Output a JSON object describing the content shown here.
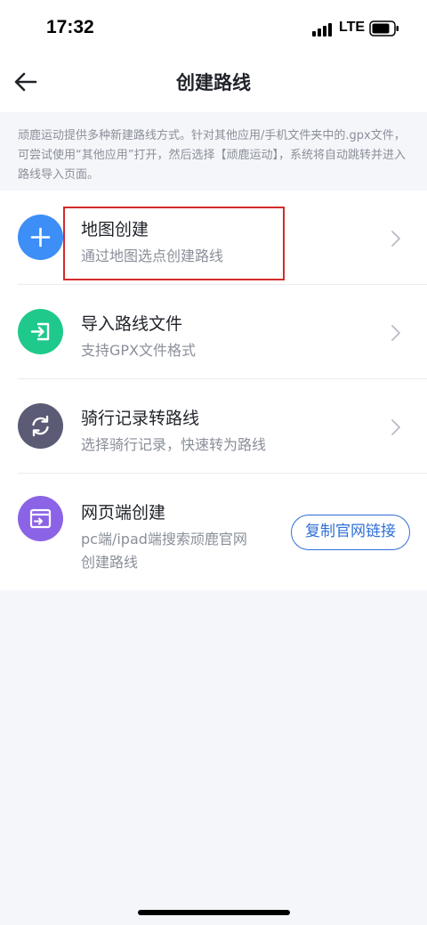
{
  "status_bar": {
    "time": "17:32",
    "network": "LTE",
    "icons": [
      "signal-icon",
      "battery-icon"
    ]
  },
  "header": {
    "title": "创建路线",
    "back_icon": "back-arrow-icon"
  },
  "intro": {
    "text": "顽鹿运动提供多种新建路线方式。针对其他应用/手机文件夹中的.gpx文件，可尝试使用“其他应用”打开，然后选择【顽鹿运动】，系统将自动跳转并进入路线导入页面。"
  },
  "options": [
    {
      "title": "地图创建",
      "description": "通过地图选点创建路线",
      "icon": "plus-icon",
      "color": "#3d8ef7"
    },
    {
      "title": "导入路线文件",
      "description": "支持GPX文件格式",
      "icon": "import-icon",
      "color": "#1fc98b"
    },
    {
      "title": "骑行记录转路线",
      "description": "选择骑行记录，快速转为路线",
      "icon": "convert-icon",
      "color": "#5b5b76"
    },
    {
      "title": "网页端创建",
      "description_line1": "pc端/ipad端搜索顽鹿官网",
      "description_line2": "创建路线",
      "icon": "web-icon",
      "color": "#8b63e6",
      "button_label": "复制官网链接"
    }
  ],
  "colors": {
    "accent": "#2f6fd6",
    "highlight": "#d42b2b",
    "background": "#f5f6fa"
  }
}
